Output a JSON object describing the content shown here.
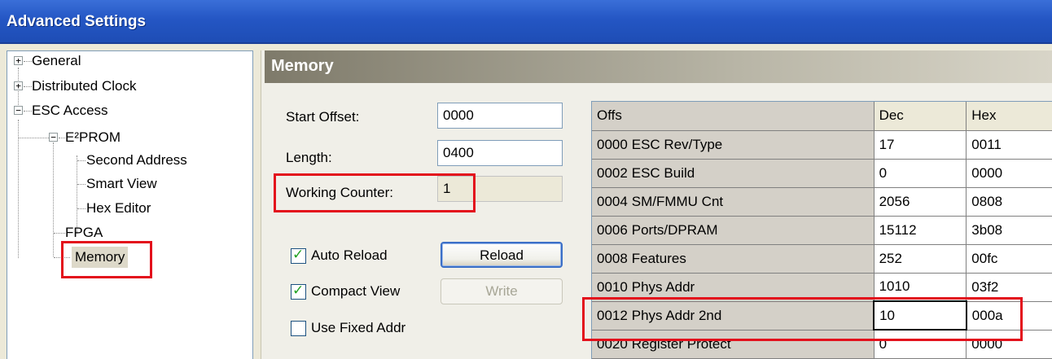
{
  "window": {
    "title": "Advanced Settings"
  },
  "tree": {
    "nodes": [
      {
        "label": "General",
        "expander": "+"
      },
      {
        "label": "Distributed Clock",
        "expander": "+"
      },
      {
        "label": "ESC Access",
        "expander": "−"
      },
      {
        "label": "E²PROM",
        "expander": "−"
      },
      {
        "label": "Second Address"
      },
      {
        "label": "Smart View"
      },
      {
        "label": "Hex Editor"
      },
      {
        "label": "FPGA"
      },
      {
        "label": "Memory",
        "selected": true
      }
    ]
  },
  "panel": {
    "title": "Memory",
    "start_offset": {
      "label": "Start Offset:",
      "value": "0000"
    },
    "length": {
      "label": "Length:",
      "value": "0400"
    },
    "working_counter": {
      "label": "Working Counter:",
      "value": "1"
    },
    "auto_reload": {
      "label": "Auto Reload",
      "checked": true
    },
    "compact_view": {
      "label": "Compact View",
      "checked": true
    },
    "use_fixed_addr": {
      "label": "Use Fixed Addr",
      "checked": false
    },
    "reload_button": "Reload",
    "write_button": "Write"
  },
  "grid": {
    "columns": [
      "Offs",
      "Dec",
      "Hex"
    ],
    "rows": [
      {
        "addr": "0000",
        "name": "ESC Rev/Type",
        "dec": "17",
        "hex": "0011"
      },
      {
        "addr": "0002",
        "name": "ESC Build",
        "dec": "0",
        "hex": "0000"
      },
      {
        "addr": "0004",
        "name": "SM/FMMU Cnt",
        "dec": "2056",
        "hex": "0808"
      },
      {
        "addr": "0006",
        "name": "Ports/DPRAM",
        "dec": "15112",
        "hex": "3b08"
      },
      {
        "addr": "0008",
        "name": "Features",
        "dec": "252",
        "hex": "00fc"
      },
      {
        "addr": "0010",
        "name": "Phys Addr",
        "dec": "1010",
        "hex": "03f2"
      },
      {
        "addr": "0012",
        "name": "Phys Addr 2nd",
        "dec": "10",
        "hex": "000a"
      },
      {
        "addr": "0020",
        "name": "Register Protect",
        "dec": "0",
        "hex": "0000"
      }
    ]
  },
  "colors": {
    "highlight": "#e3101c",
    "title_bar": "#2456c4"
  }
}
